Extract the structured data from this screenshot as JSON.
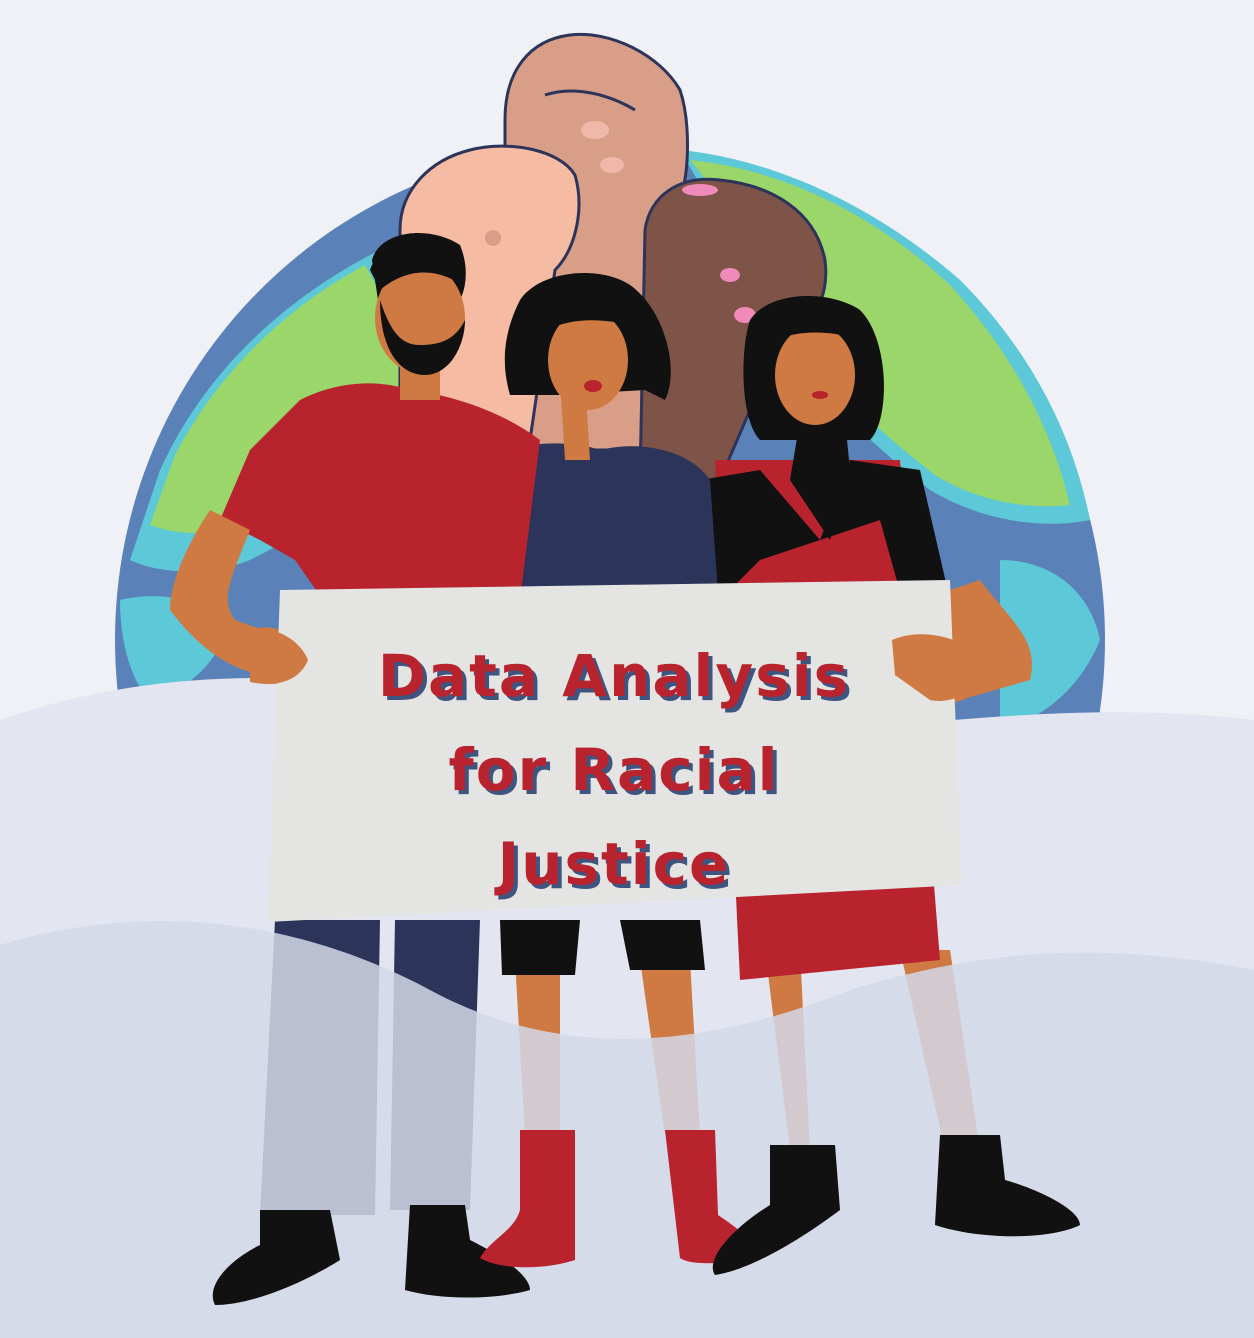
{
  "sign": {
    "lines": [
      "Data Analysis",
      "for Racial",
      "Justice"
    ]
  },
  "colors": {
    "background": "#eff1f7",
    "hill_back": "#e3e6f0",
    "hill_front": "#d3d8e8",
    "globe_water": "#5a82b8",
    "globe_land": "#9bd66a",
    "globe_shallow": "#5cc8d8",
    "sign_board": "#e4e4e2",
    "sign_text": "#b8232e",
    "sign_text_shadow": "#3d5580",
    "shirt_red": "#b8232e",
    "navy": "#2c3459",
    "skin": "#cf7a42",
    "black": "#111111"
  },
  "icons": [
    "globe-illustration",
    "raised-fist-icon",
    "person-illustration"
  ]
}
